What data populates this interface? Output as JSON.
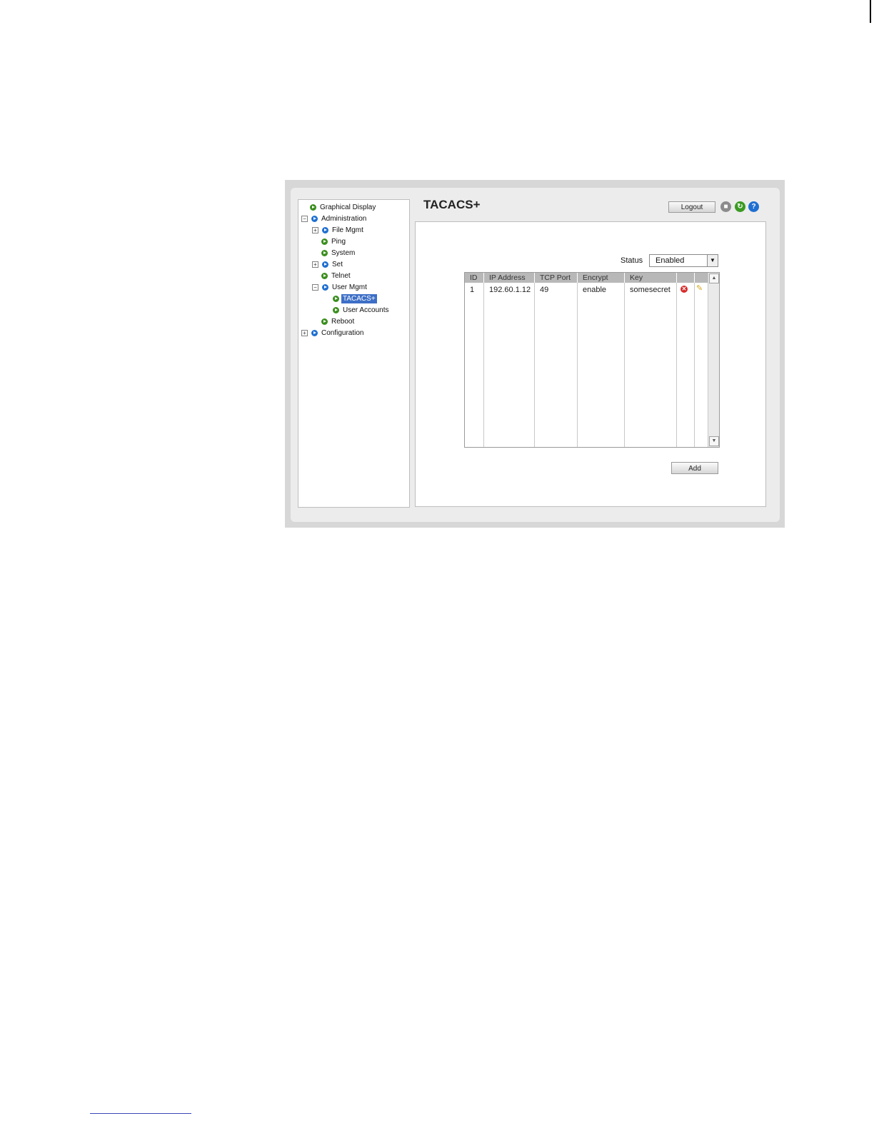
{
  "page": {
    "title": "TACACS+"
  },
  "header": {
    "logout_label": "Logout",
    "save_glyph": "■",
    "refresh_glyph": "↻",
    "help_glyph": "?"
  },
  "tree": {
    "items": [
      {
        "label": "Graphical Display",
        "bullet": "green"
      },
      {
        "label": "Administration",
        "bullet": "blue",
        "expander": "−"
      },
      {
        "label": "File Mgmt",
        "bullet": "blue",
        "expander": "+"
      },
      {
        "label": "Ping",
        "bullet": "green"
      },
      {
        "label": "System",
        "bullet": "green"
      },
      {
        "label": "Set",
        "bullet": "blue",
        "expander": "+"
      },
      {
        "label": "Telnet",
        "bullet": "green"
      },
      {
        "label": "User Mgmt",
        "bullet": "blue",
        "expander": "−"
      },
      {
        "label": "TACACS+",
        "bullet": "green",
        "selected": true
      },
      {
        "label": "User Accounts",
        "bullet": "green"
      },
      {
        "label": "Reboot",
        "bullet": "green"
      },
      {
        "label": "Configuration",
        "bullet": "blue",
        "expander": "+"
      }
    ]
  },
  "status": {
    "label": "Status",
    "value": "Enabled",
    "arrow_glyph": "▼"
  },
  "table": {
    "columns": [
      "ID",
      "IP Address",
      "TCP Port",
      "Encrypt",
      "Key",
      "",
      ""
    ],
    "rows": [
      {
        "id": "1",
        "ip": "192.60.1.12",
        "port": "49",
        "encrypt": "enable",
        "key": "somesecret"
      }
    ],
    "delete_glyph": "✕",
    "edit_glyph": "✎"
  },
  "actions": {
    "add_label": "Add"
  },
  "colors": {
    "selected": "#3d6fc6",
    "header": "#b8b8b8",
    "green_bullet": "#3a8e1d",
    "blue_bullet": "#1f6fd1"
  }
}
